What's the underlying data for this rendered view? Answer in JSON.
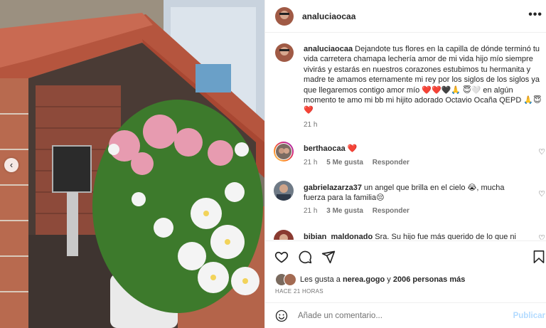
{
  "post": {
    "username": "analuciaocaa",
    "more_icon": "more-horizontal-icon",
    "carousel_prev": "‹"
  },
  "caption": {
    "username": "analuciaocaa",
    "text": "Dejandote tus flores en la capilla de dónde terminó tu vida carretera chamapa lechería amor de mi vida hijo mío siempre vivirás y estarás en nuestros corazones estubimos tu hermanita y madre te amamos eternamente mi rey por los siglos de los siglos ya que llegaremos contigo amor mío ❤️❤️🖤🙏 😇🤍 en algún momento te amo mi bb mi hijito adorado Octavio Ocaña QEPD 🙏😇❤️",
    "time": "21 h"
  },
  "comments": [
    {
      "username": "berthaocaa",
      "text": "❤️",
      "time": "21 h",
      "likes": "5 Me gusta",
      "reply": "Responder"
    },
    {
      "username": "gabrielazarza37",
      "text": "un angel que brilla en el cielo 😭, mucha fuerza para la familia😔",
      "time": "21 h",
      "likes": "3 Me gusta",
      "reply": "Responder"
    },
    {
      "username": "bibian_maldonado",
      "text": "Sra. Su hijo fue más querido de lo que ni él"
    }
  ],
  "actions": {
    "like_icon": "heart-outline-icon",
    "comment_icon": "comment-icon",
    "share_icon": "paper-plane-icon",
    "save_icon": "bookmark-icon"
  },
  "likes": {
    "prefix": "Les gusta a",
    "user": "nerea.gogo",
    "joiner": "y",
    "others": "2006 personas más"
  },
  "age": "HACE 21 HORAS",
  "add_comment": {
    "placeholder": "Añade un comentario...",
    "publish": "Publicar"
  },
  "colors": {
    "text": "#262626",
    "secondary": "#737373",
    "border": "#efefef",
    "heart_red": "#ed2b3f",
    "publish_disabled": "#b3dbff"
  }
}
